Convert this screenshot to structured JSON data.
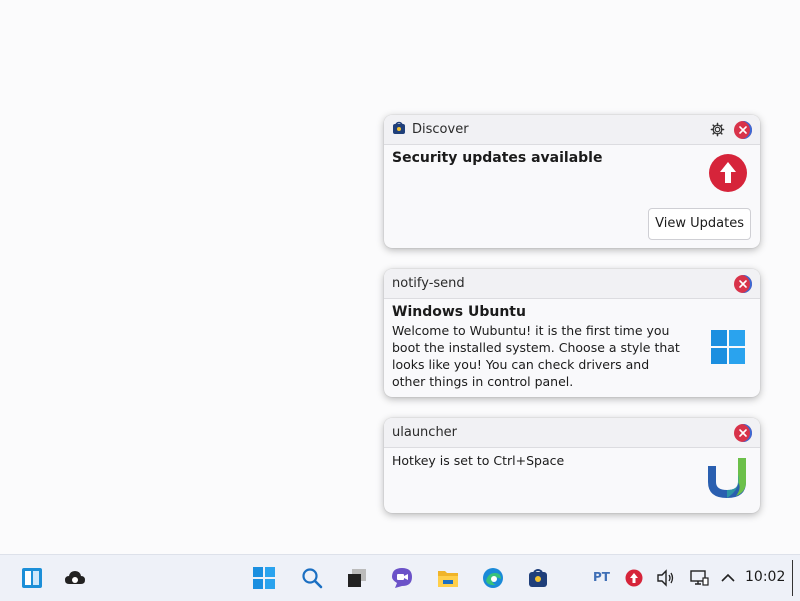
{
  "notifications": [
    {
      "app": "Discover",
      "title": "Security updates available",
      "body": "",
      "action": "View Updates"
    },
    {
      "app": "notify-send",
      "title": "Windows Ubuntu",
      "body": "Welcome to Wubuntu! it is the first time you boot the installed system. Choose a style that looks like you! You can check drivers and other things in control panel."
    },
    {
      "app": "ulauncher",
      "title": "",
      "body": "Hotkey is set to Ctrl+Space"
    }
  ],
  "taskbar": {
    "language": "PT",
    "clock": "10:02",
    "icons": [
      "widgets-icon",
      "cloud-sync-icon",
      "start-icon",
      "search-icon",
      "task-view-icon",
      "chat-icon",
      "file-explorer-icon",
      "edge-icon",
      "discover-icon",
      "update-tray-icon",
      "volume-icon",
      "network-icon",
      "chevron-up-icon"
    ]
  },
  "colors": {
    "accent_red": "#d8334a",
    "accent_blue": "#0078d4",
    "taskbar": "#eef1f8"
  }
}
